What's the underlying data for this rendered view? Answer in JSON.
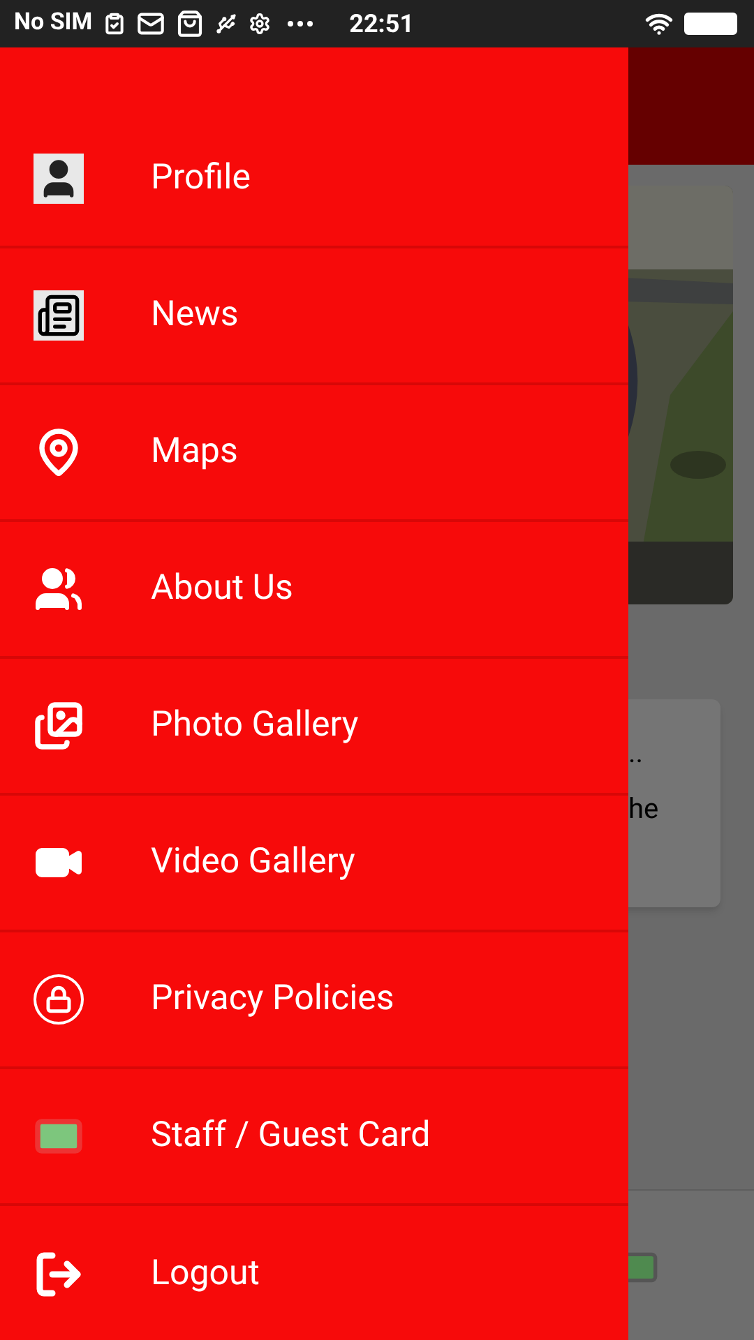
{
  "status_bar": {
    "carrier": "No SIM",
    "time": "22:51"
  },
  "drawer": {
    "items": [
      {
        "label": "Profile"
      },
      {
        "label": "News"
      },
      {
        "label": "Maps"
      },
      {
        "label": "About Us"
      },
      {
        "label": "Photo Gallery"
      },
      {
        "label": "Video Gallery"
      },
      {
        "label": "Privacy Policies"
      },
      {
        "label": "Staff / Guest Card"
      },
      {
        "label": "Logout"
      }
    ]
  },
  "background": {
    "card_title": "..",
    "card_text": "he"
  }
}
